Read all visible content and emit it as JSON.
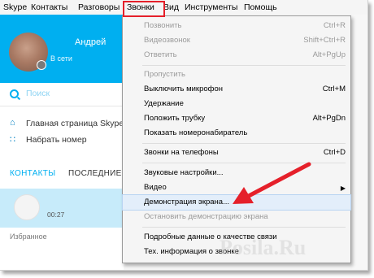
{
  "menubar": {
    "items": [
      "Skype",
      "Контакты",
      "Разговоры",
      "Звонки",
      "Вид",
      "Инструменты",
      "Помощь"
    ],
    "active": "Звонки"
  },
  "profile": {
    "name": "Андрей",
    "status": "В сети"
  },
  "search": {
    "label": "Поиск"
  },
  "nav": {
    "home": "Главная страница Skype",
    "dial": "Набрать номер"
  },
  "tabs": {
    "contacts": "КОНТАКТЫ",
    "recent": "ПОСЛЕДНИЕ"
  },
  "contact": {
    "time": "00:27"
  },
  "favorites": "Избранное",
  "call_menu": {
    "items": [
      {
        "label": "Позвонить",
        "shortcut": "Ctrl+R",
        "enabled": false
      },
      {
        "label": "Видеозвонок",
        "shortcut": "Shift+Ctrl+R",
        "enabled": false
      },
      {
        "label": "Ответить",
        "shortcut": "Alt+PgUp",
        "enabled": false
      },
      {
        "label": "Пропустить",
        "shortcut": "",
        "enabled": false
      },
      {
        "label": "Выключить микрофон",
        "shortcut": "Ctrl+M",
        "enabled": true
      },
      {
        "label": "Удержание",
        "shortcut": "",
        "enabled": true
      },
      {
        "label": "Положить трубку",
        "shortcut": "Alt+PgDn",
        "enabled": true
      },
      {
        "label": "Показать номеронабиратель",
        "shortcut": "",
        "enabled": true
      },
      {
        "label": "Звонки на телефоны",
        "shortcut": "Ctrl+D",
        "enabled": true
      },
      {
        "label": "Звуковые настройки...",
        "shortcut": "",
        "enabled": true
      },
      {
        "label": "Видео",
        "shortcut": "",
        "enabled": true,
        "submenu": true
      },
      {
        "label": "Демонстрация экрана...",
        "shortcut": "",
        "enabled": true,
        "highlighted": true
      },
      {
        "label": "Остановить демонстрацию экрана",
        "shortcut": "",
        "enabled": false
      },
      {
        "label": "Подробные данные о качестве связи",
        "shortcut": "",
        "enabled": true
      },
      {
        "label": "Тех. информация о звонке",
        "shortcut": "",
        "enabled": true
      }
    ]
  },
  "colors": {
    "skype_blue": "#00aff0",
    "highlight_box": "#e5202a",
    "arrow": "#e5202a",
    "menu_bg": "#f5f5f5"
  },
  "watermark": "Posila.Ru",
  "icons": [
    "search-icon",
    "home-icon",
    "dial-icon",
    "submenu-arrow-icon",
    "pointer-arrow"
  ]
}
